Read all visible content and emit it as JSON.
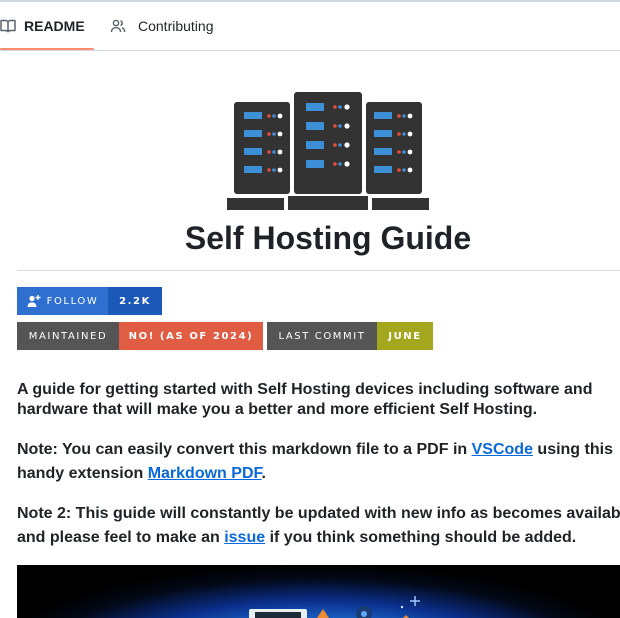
{
  "tabs": [
    {
      "label": "README",
      "icon": "book-icon",
      "active": true
    },
    {
      "label": "Contributing",
      "icon": "people-icon",
      "active": false
    }
  ],
  "title": "Self Hosting Guide",
  "badges": {
    "follow": {
      "label": "FOLLOW",
      "value": "2.2K",
      "icon": "person-add-icon"
    },
    "maintained": {
      "label": "MAINTAINED",
      "value": "NO! (AS OF 2024)"
    },
    "last_commit": {
      "label": "LAST COMMIT",
      "value": "JUNE"
    }
  },
  "intro": "A guide for getting started with Self Hosting devices including software and hardware that will make you a better and more efficient Self Hosting.",
  "note1": {
    "before": "Note: You can easily convert this markdown file to a PDF in ",
    "link1": "VSCode",
    "middle": " using this handy extension ",
    "link2": "Markdown PDF",
    "after": "."
  },
  "note2": {
    "before": "Note 2: This guide will constantly be updated with new info as becomes available and please feel to make an ",
    "link": "issue",
    "after": " if you think something should be added."
  },
  "colors": {
    "accent_underline": "#fd8c73",
    "link": "#0969da",
    "badge_follow": "#2f6fd0",
    "badge_maintained_value": "#e05d44",
    "badge_commit_value": "#a4a61d",
    "server_body": "#333333",
    "server_led_red": "#e74c3c",
    "server_slot": "#3d8fd6"
  }
}
